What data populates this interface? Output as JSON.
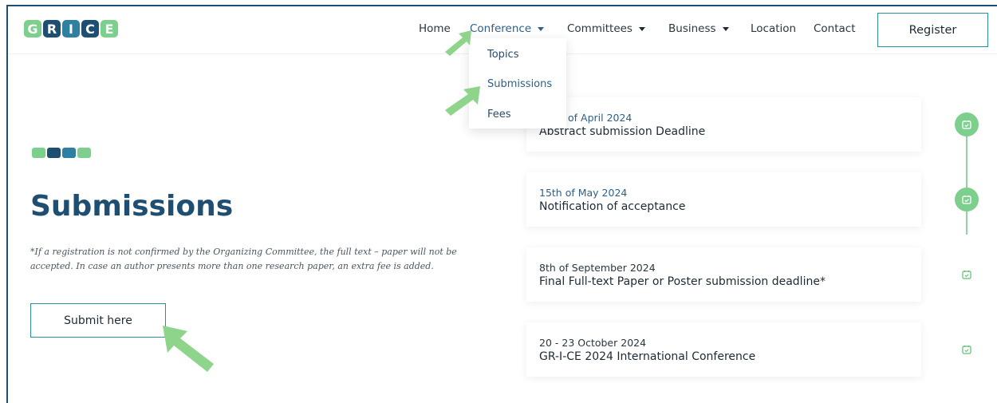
{
  "logo": {
    "letters": [
      "G",
      "R",
      "I",
      "C",
      "E"
    ]
  },
  "nav": {
    "items": [
      {
        "label": "Home"
      },
      {
        "label": "Conference"
      },
      {
        "label": "Committees"
      },
      {
        "label": "Business"
      },
      {
        "label": "Location"
      },
      {
        "label": "Contact"
      }
    ],
    "register_label": "Register"
  },
  "dropdown": {
    "items": [
      {
        "label": "Topics"
      },
      {
        "label": "Submissions"
      },
      {
        "label": "Fees"
      }
    ]
  },
  "page": {
    "title": "Submissions",
    "note": "*If a registration is not confirmed by the Organizing Committee, the full text – paper will not be accepted. In case an author presents more than one research paper, an extra fee is added.",
    "submit_label": "Submit here"
  },
  "timeline": [
    {
      "date": "of April 2024",
      "title": "Abstract submission Deadline"
    },
    {
      "date": "15th of May 2024",
      "title": "Notification of acceptance"
    },
    {
      "date": "8th of September 2024",
      "title": "Final Full-text Paper or Poster submission deadline*"
    },
    {
      "date": "20 - 23 October 2024",
      "title": "GR-I-CE 2024 International Conference"
    }
  ],
  "colors": {
    "brand_dark": "#1f4e73",
    "brand_green": "#7dcf8e",
    "accent_teal": "#2a8f9f",
    "link_blue": "#2c5f8a",
    "arrow_green": "#8ed48a"
  }
}
